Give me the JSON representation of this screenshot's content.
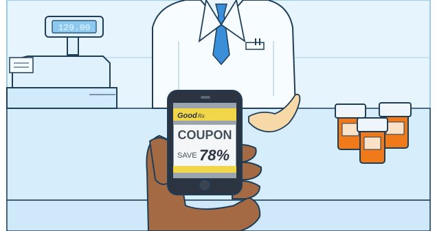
{
  "register": {
    "display_amount": "129.00"
  },
  "phone": {
    "brand": "GoodRx",
    "brand_short": "Good",
    "brand_suffix": "Rx",
    "coupon_title": "COUPON",
    "save_word": "SAVE",
    "discount": "78%"
  },
  "colors": {
    "sky": "#d9eefc",
    "wall_line": "#8cc4ea",
    "counter": "#cfe9fb",
    "outline": "#1d3d59",
    "coat": "#f4fbff",
    "tie": "#3a8fd8",
    "skin": "#b07a52",
    "skin_dark": "#8a5a38",
    "bottle": "#f07a1a",
    "phone_body": "#2b3440",
    "phone_yellow": "#f2d64a",
    "phone_screen": "#f4f6f8"
  },
  "icons": [
    "cash-register-icon",
    "pharmacist-figure",
    "pill-bottle-icon",
    "smartphone-icon",
    "hand-icon"
  ]
}
